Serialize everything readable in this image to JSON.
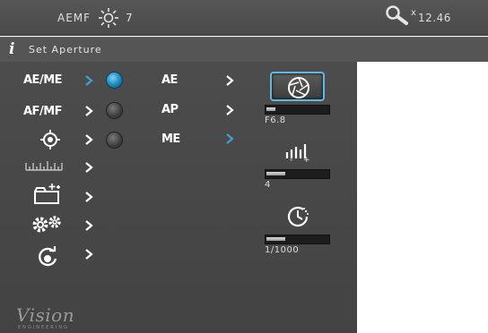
{
  "header": {
    "mode_label": "AEMF",
    "sun_icon": "sun-icon",
    "sun_value": "7",
    "zoom_icon": "magnifier-icon",
    "zoom_x": "x",
    "zoom_value": "12.46"
  },
  "info": {
    "icon": "info-i-icon",
    "icon_char": "i",
    "text": "Set Aperture"
  },
  "menu": {
    "items": [
      {
        "label": "AE/ME",
        "active": true
      },
      {
        "label": "AF/MF",
        "active": false
      },
      {
        "icon": "crosshair-target-icon"
      },
      {
        "icon": "ruler-scale-icon"
      },
      {
        "icon": "folder-sparkle-icon"
      },
      {
        "icon": "gears-icon"
      },
      {
        "icon": "camera-refresh-icon"
      }
    ]
  },
  "submenu": {
    "options": [
      {
        "label": "AE",
        "selected": true
      },
      {
        "label": "AP",
        "selected": false
      },
      {
        "label": "ME",
        "selected": false
      }
    ]
  },
  "controls": {
    "aperture": {
      "icon": "aperture-icon",
      "value": "F6.8",
      "level": 0.14
    },
    "exposure_comp": {
      "icon": "exposure-scale-icon",
      "value": "4",
      "minus": "-",
      "plus": "+",
      "level": 0.3
    },
    "shutter": {
      "icon": "timer-icon",
      "value": "1/1000",
      "level": 0.3
    }
  },
  "logo": {
    "name": "Vision",
    "sub": "ENGINEERING"
  },
  "colors": {
    "accent": "#3aa0d8",
    "panel": "#484848",
    "text": "#ffffff"
  }
}
